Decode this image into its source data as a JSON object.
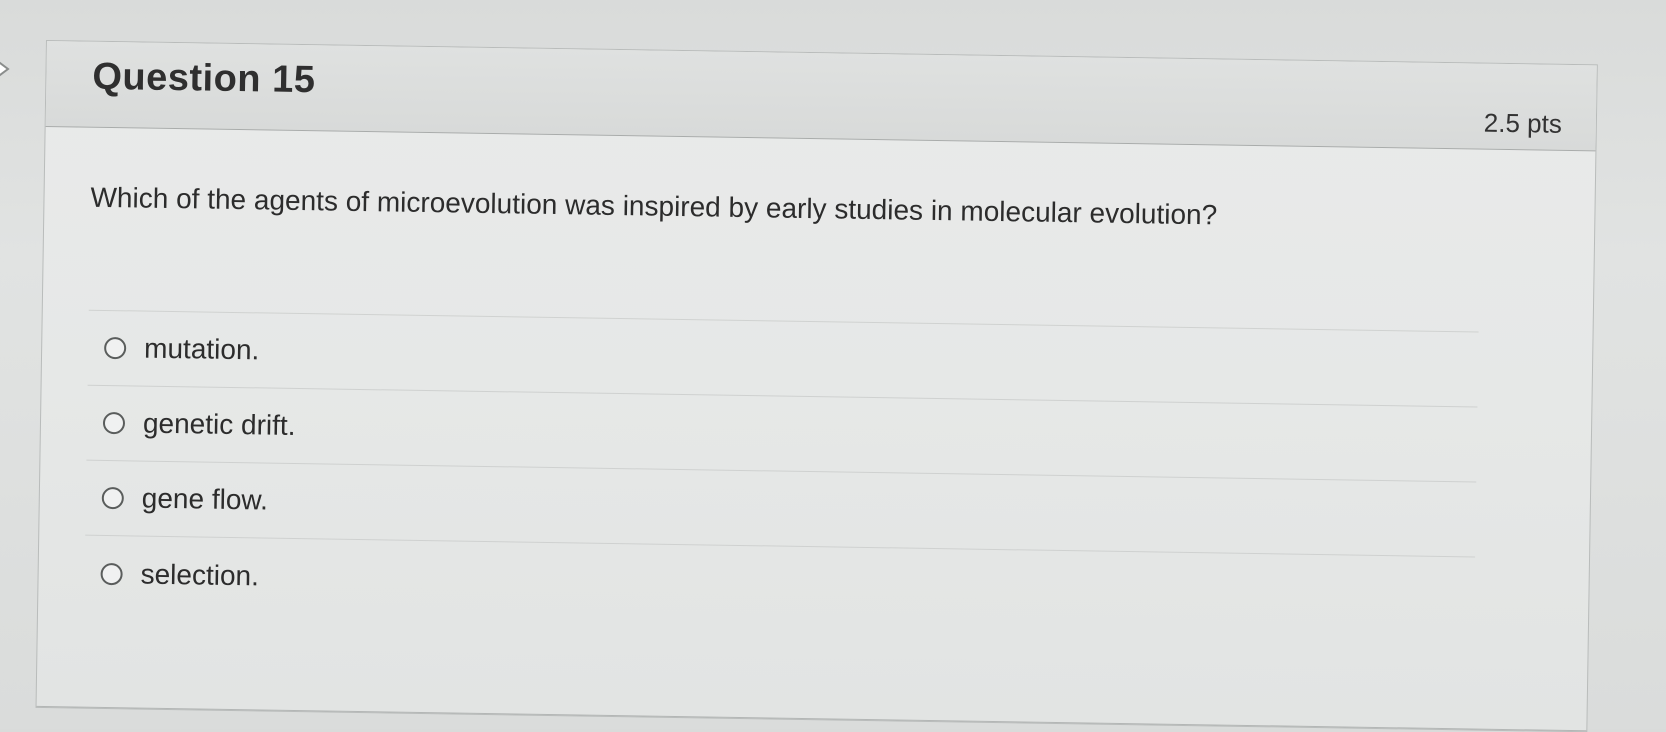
{
  "question": {
    "title": "Question 15",
    "points": "2.5 pts",
    "text": "Which of the agents of microevolution was inspired by early studies in molecular evolution?"
  },
  "answers": [
    {
      "label": "mutation."
    },
    {
      "label": "genetic drift."
    },
    {
      "label": "gene flow."
    },
    {
      "label": "selection."
    }
  ],
  "icons": {
    "nav": "chevron-right-icon",
    "option": "radio-circle-icon"
  },
  "colors": {
    "background": "#dcdedd",
    "card": "#e7e9e8",
    "text": "#2c2c2c",
    "border": "#b9bcbb"
  }
}
